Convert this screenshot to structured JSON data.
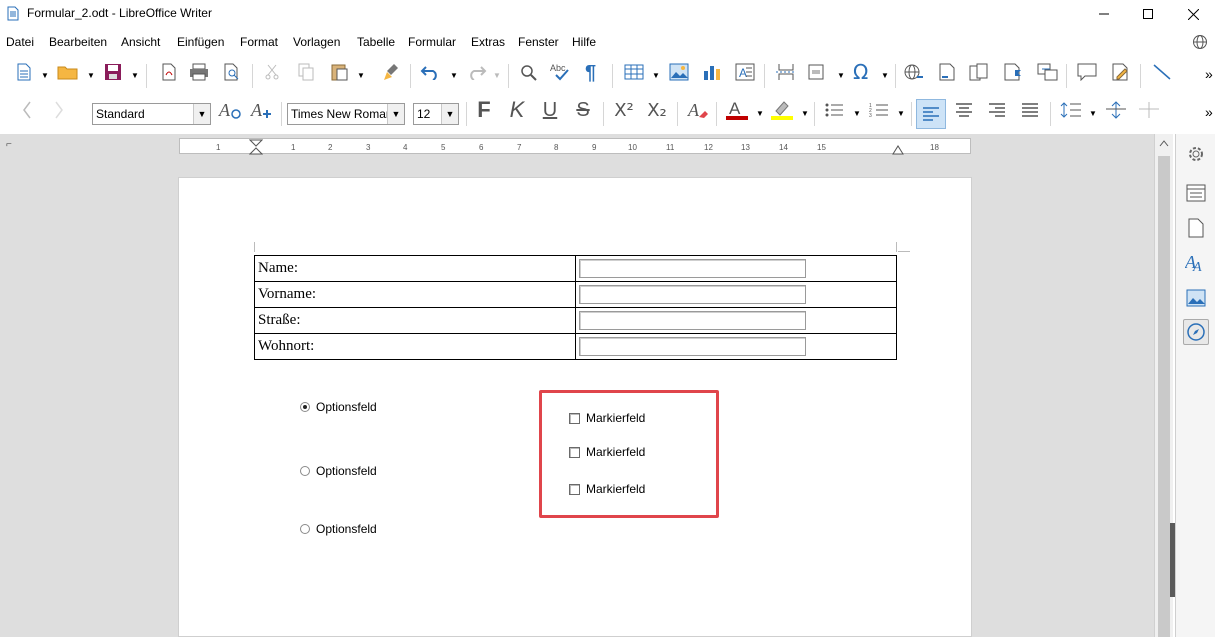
{
  "window": {
    "title": "Formular_2.odt - LibreOffice Writer",
    "minimize": "—",
    "maximize": "☐",
    "close": "✕"
  },
  "menu": [
    "Datei",
    "Bearbeiten",
    "Ansicht",
    "Einfügen",
    "Format",
    "Vorlagen",
    "Tabelle",
    "Formular",
    "Extras",
    "Fenster",
    "Hilfe"
  ],
  "toolbar2": {
    "paragraph_style": "Standard",
    "font_name": "Times New Roman",
    "font_size": "12",
    "bold": "F",
    "italic": "K",
    "underline": "U",
    "strike": "S",
    "superscript": "X²",
    "subscript": "X₂"
  },
  "ruler": {
    "ticks": [
      "1",
      "1",
      "2",
      "3",
      "4",
      "5",
      "6",
      "7",
      "8",
      "9",
      "10",
      "11",
      "12",
      "13",
      "14",
      "15",
      "16",
      "18"
    ]
  },
  "form": {
    "rows": [
      {
        "label": "Name:",
        "value": ""
      },
      {
        "label": "Vorname:",
        "value": ""
      },
      {
        "label": "Straße:",
        "value": ""
      },
      {
        "label": "Wohnort:",
        "value": ""
      }
    ],
    "options": [
      {
        "label": "Optionsfeld",
        "selected": true
      },
      {
        "label": "Optionsfeld",
        "selected": false
      },
      {
        "label": "Optionsfeld",
        "selected": false
      }
    ],
    "checkboxes": [
      {
        "label": "Markierfeld",
        "checked": false
      },
      {
        "label": "Markierfeld",
        "checked": false
      },
      {
        "label": "Markierfeld",
        "checked": false
      }
    ]
  },
  "colors": {
    "highlight_border": "#e0454b",
    "accent_blue": "#2a6fb8",
    "font_color_red": "#c00000",
    "highlight_yellow": "#ffff00"
  }
}
